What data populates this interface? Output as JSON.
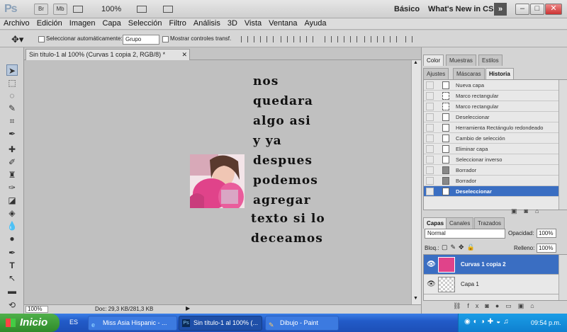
{
  "titlebar": {
    "app_logo": "Ps",
    "btn_br": "Br",
    "btn_mb": "Mb",
    "zoom": "100%",
    "workspace": "Básico",
    "whats_new": "What's New in CS5"
  },
  "menu": [
    "Archivo",
    "Edición",
    "Imagen",
    "Capa",
    "Selección",
    "Filtro",
    "Análisis",
    "3D",
    "Vista",
    "Ventana",
    "Ayuda"
  ],
  "options": {
    "auto_select_label": "Seleccionar automáticamente:",
    "auto_select_value": "Grupo",
    "show_transform_label": "Mostrar controles transf."
  },
  "document": {
    "tab_title": "Sin título-1 al 100% (Curvas 1 copia 2, RGB/8) *",
    "text_lines": [
      "nos",
      "quedara",
      "algo asi",
      "y ya",
      "despues",
      "podemos",
      "agregar",
      "texto si lo",
      "deceamos"
    ],
    "status_zoom": "100%",
    "status_doc": "Doc: 29,3 KB/281,3 KB"
  },
  "panels": {
    "top_tabs": [
      "Color",
      "Muestras",
      "Estilos"
    ],
    "mid_tabs": [
      "Ajustes",
      "Máscaras",
      "Historia"
    ],
    "history": [
      "Nueva capa",
      "Marco rectangular",
      "Marco rectangular",
      "Deseleccionar",
      "Herramienta Rectángulo redondeado",
      "Cambio de selección",
      "Eliminar capa",
      "Seleccionar inverso",
      "Borrador",
      "Borrador",
      "Deseleccionar"
    ],
    "layers_tabs": [
      "Capas",
      "Canales",
      "Trazados"
    ],
    "blend_mode": "Normal",
    "opacity_label": "Opacidad:",
    "opacity_value": "100%",
    "lock_label": "Bloq.:",
    "fill_label": "Relleno:",
    "fill_value": "100%",
    "layers": [
      "Curvas 1 copia 2",
      "Capa 1"
    ]
  },
  "taskbar": {
    "start": "Inicio",
    "lang": "ES",
    "tasks": [
      "Miss Asia Hispanic - ...",
      "Sin título-1 al 100% (...",
      "Dibujo - Paint"
    ],
    "clock": "09:54 p.m."
  },
  "colors": {
    "accent": "#3a6ec2",
    "taskbar": "#225bc8",
    "start": "#3a9a34"
  }
}
